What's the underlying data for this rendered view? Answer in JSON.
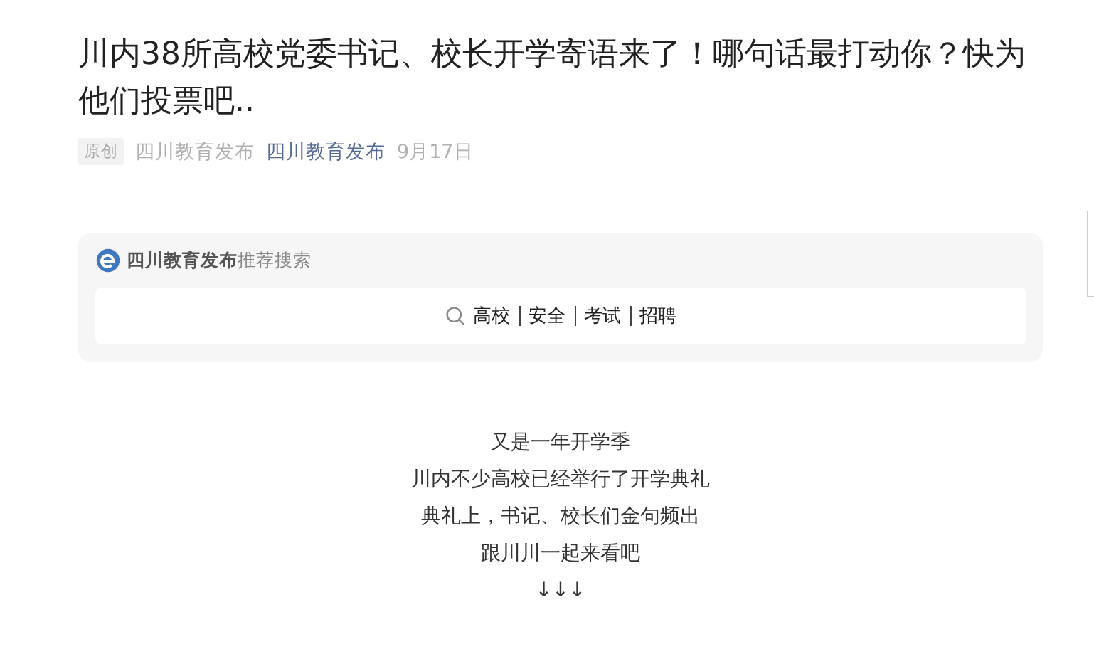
{
  "article": {
    "title": "川内38所高校党委书记、校长开学寄语来了！哪句话最打动你？快为他们投票吧..",
    "meta": {
      "badge": "原创",
      "author": "四川教育发布",
      "account": "四川教育发布",
      "date": "9月17日"
    }
  },
  "search_card": {
    "brand": "四川教育发布",
    "label": "推荐搜索",
    "keywords": [
      "高校",
      "安全",
      "考试",
      "招聘"
    ]
  },
  "body_lines": [
    "又是一年开学季",
    "川内不少高校已经举行了开学典礼",
    "典礼上，书记、校长们金句频出",
    "跟川川一起来看吧",
    "↓↓↓"
  ]
}
